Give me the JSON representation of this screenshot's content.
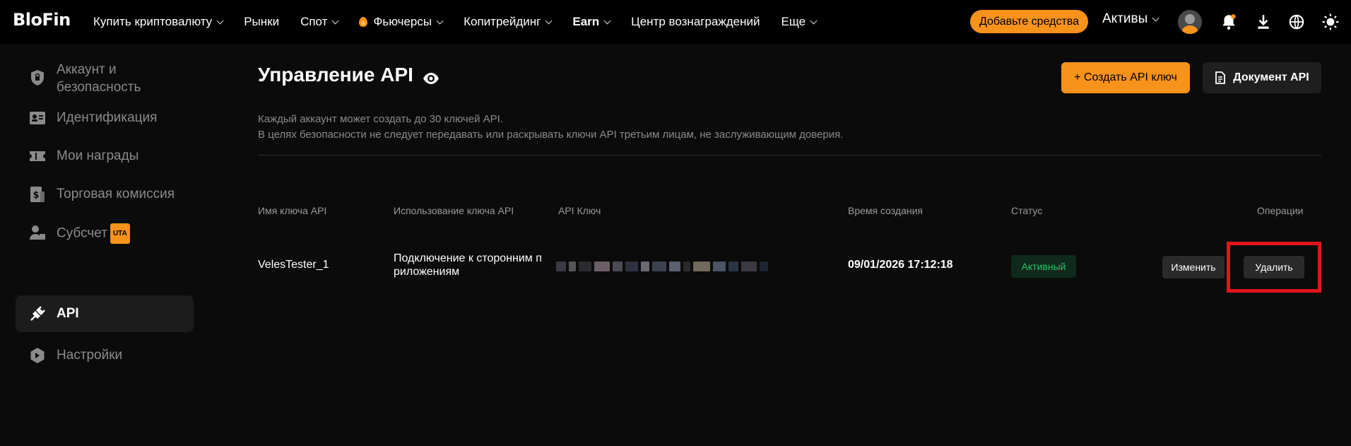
{
  "header": {
    "logo": "BloFin",
    "nav": [
      {
        "label": "Купить криптовалюту",
        "chevron": true,
        "bold": false
      },
      {
        "label": "Рынки",
        "chevron": false,
        "bold": false
      },
      {
        "label": "Спот",
        "chevron": true,
        "bold": false
      },
      {
        "label": "Фьючерсы",
        "chevron": true,
        "bold": false,
        "icon": "fire-icon"
      },
      {
        "label": "Копитрейдинг",
        "chevron": true,
        "bold": false
      },
      {
        "label": "Earn",
        "chevron": true,
        "bold": true
      },
      {
        "label": "Центр вознаграждений",
        "chevron": false,
        "bold": false
      },
      {
        "label": "Еще",
        "chevron": true,
        "bold": false
      }
    ],
    "deposit_label": "Добавьте средства",
    "assets_label": "Активы",
    "icons": [
      "user-avatar",
      "bell-icon",
      "download-icon",
      "globe-icon",
      "sun-icon"
    ],
    "accent_color": "#f7921a"
  },
  "sidebar": {
    "items": [
      {
        "label": "Аккаунт и\nбезопасность",
        "icon": "shield-icon",
        "active": false
      },
      {
        "label": "Идентификация",
        "icon": "id-card-icon",
        "active": false
      },
      {
        "label": "Мои награды",
        "icon": "ticket-icon",
        "active": false
      },
      {
        "label": "Торговая комиссия",
        "icon": "fee-icon",
        "active": false
      },
      {
        "label": "Субсчет",
        "icon": "subaccount-icon",
        "active": false,
        "badge": "UTA"
      },
      {
        "label": "API",
        "icon": "plug-icon",
        "active": true
      },
      {
        "label": "Настройки",
        "icon": "settings-icon",
        "active": false
      }
    ]
  },
  "main": {
    "title": "Управление API",
    "create_button": "+ Создать API ключ",
    "doc_button": "Документ API",
    "desc_line1": "Каждый аккаунт может создать до 30 ключей API.",
    "desc_line2": "В целях безопасности не следует передавать или раскрывать ключи API третьим лицам, не заслуживающим доверия.",
    "table": {
      "headers": {
        "name": "Имя ключа API",
        "usage": "Использование ключа API",
        "key": "API Ключ",
        "created": "Время создания",
        "status": "Статус",
        "ops": "Операции"
      },
      "rows": [
        {
          "name": "VelesTester_1",
          "usage": "Подключение к сторонним п риложениям",
          "key_masked": true,
          "created": "09/01/2026 17:12:18",
          "status": "Активный",
          "edit": "Изменить",
          "delete": "Удалить"
        }
      ]
    },
    "status_color": "#26c168",
    "highlight_color": "#e0161b"
  }
}
